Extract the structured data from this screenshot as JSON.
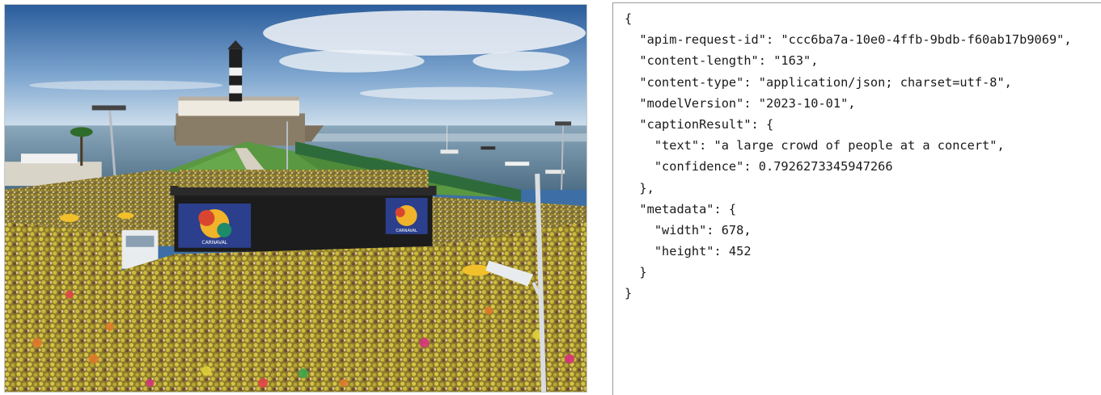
{
  "image": {
    "caption": "a large crowd of people at a concert",
    "sign_left": "CARNAVAL",
    "sign_right": "CARNAVAL"
  },
  "json_viewer": {
    "lines": [
      "{",
      "  \"apim-request-id\": \"ccc6ba7a-10e0-4ffb-9bdb-f60ab17b9069\",",
      "  \"content-length\": \"163\",",
      "  \"content-type\": \"application/json; charset=utf-8\",",
      "  \"modelVersion\": \"2023-10-01\",",
      "  \"captionResult\": {",
      "    \"text\": \"a large crowd of people at a concert\",",
      "    \"confidence\": 0.7926273345947266",
      "  },",
      "  \"metadata\": {",
      "    \"width\": 678,",
      "    \"height\": 452",
      "  }",
      "}"
    ]
  },
  "colors": {
    "sky_top": "#2f63a3",
    "sky_bottom": "#cfe0ef",
    "sea": "#6f8fa6",
    "grass": "#4f8a3a",
    "crowd_yellow": "#c9b73a",
    "text": "#1a1a1a",
    "panel_border": "#9a9a9a"
  }
}
